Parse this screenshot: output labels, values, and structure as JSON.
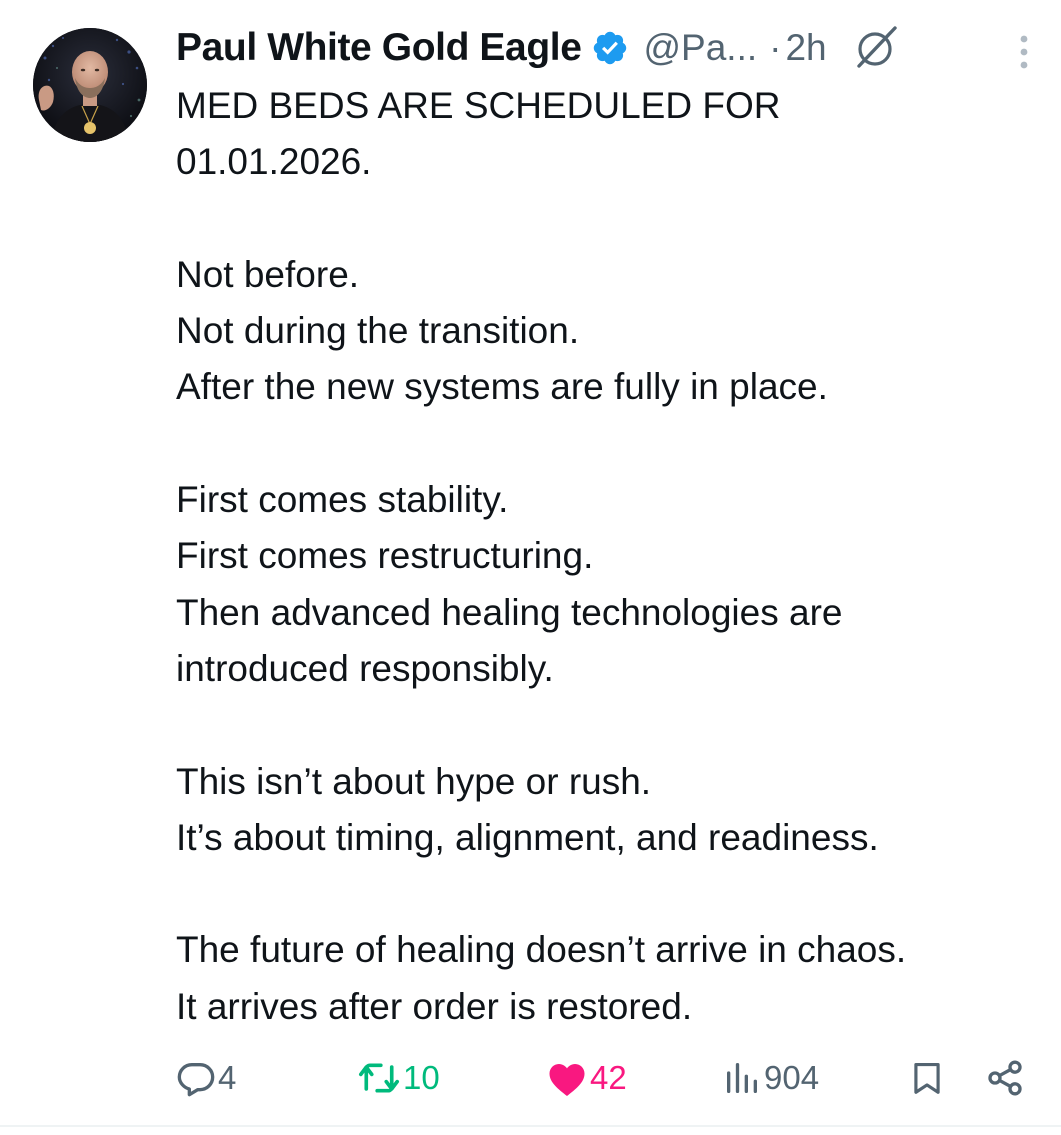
{
  "author": {
    "display_name": "Paul White Gold Eagle",
    "handle": "@Pa...",
    "separator": "·",
    "time": "2h",
    "verified": true
  },
  "colors": {
    "text": "#0f1419",
    "secondary": "#536471",
    "verified_blue": "#1d9bf0",
    "retweet_green": "#00ba7c",
    "like_pink": "#f91880"
  },
  "tweet": {
    "paragraphs": [
      [
        "MED BEDS ARE SCHEDULED FOR",
        "01.01.2026."
      ],
      [
        "Not before.",
        "Not during the transition.",
        "After the new systems are fully in place."
      ],
      [
        "First comes stability.",
        "First comes restructuring.",
        "Then advanced healing technologies are",
        "introduced responsibly."
      ],
      [
        "This isn’t about hype or rush.",
        "It’s about timing, alignment, and readiness."
      ],
      [
        "The future of healing doesn’t arrive in chaos.",
        "It arrives after order is restored."
      ]
    ]
  },
  "actions": {
    "replies": "4",
    "retweets": "10",
    "likes": "42",
    "liked": true,
    "views": "904"
  },
  "icons": {
    "reply": "reply-bubble-icon",
    "retweet": "retweet-icon",
    "like": "heart-icon",
    "views": "views-bar-icon",
    "bookmark": "bookmark-icon",
    "share": "share-icon",
    "grok": "grok-icon",
    "more": "more-vertical-icon",
    "verified": "verified-badge-icon"
  }
}
